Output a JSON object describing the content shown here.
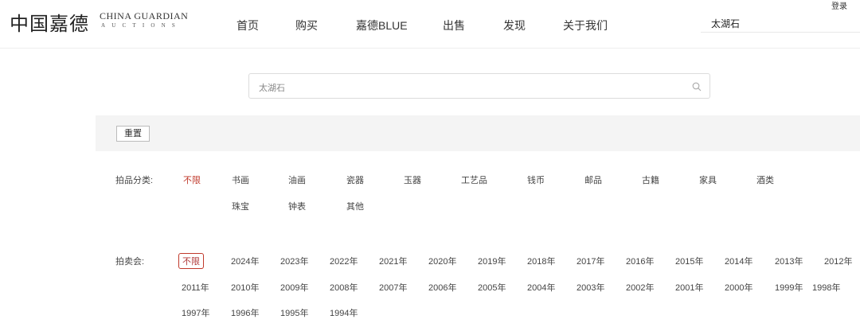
{
  "header": {
    "logo_cn": "中国嘉德",
    "logo_en_line1": "CHINA GUARDIAN",
    "logo_en_line2": "AUCTIONS",
    "nav": [
      "首页",
      "购买",
      "嘉德BLUE",
      "出售",
      "发现",
      "关于我们"
    ],
    "search_text": "太湖石",
    "login": "登录"
  },
  "search": {
    "value": "太湖石",
    "icon": "search-icon"
  },
  "filters": {
    "reset_label": "重置",
    "category_label": "拍品分类:",
    "categories": [
      "不限",
      "书画",
      "油画",
      "瓷器",
      "玉器",
      "工艺品",
      "钱币",
      "邮品",
      "古籍",
      "家具",
      "酒类",
      "珠宝",
      "钟表",
      "其他"
    ],
    "category_active": "不限",
    "auction_label": "拍卖会:",
    "years": [
      "不限",
      "2024年",
      "2023年",
      "2022年",
      "2021年",
      "2020年",
      "2019年",
      "2018年",
      "2017年",
      "2016年",
      "2015年",
      "2014年",
      "2013年",
      "2012年",
      "2011年",
      "2010年",
      "2009年",
      "2008年",
      "2007年",
      "2006年",
      "2005年",
      "2004年",
      "2003年",
      "2002年",
      "2001年",
      "2000年",
      "1999年",
      "1998年",
      "1997年",
      "1996年",
      "1995年",
      "1994年"
    ],
    "year_active": "不限"
  },
  "colors": {
    "accent": "#c0392b",
    "filter_bg": "#f4f4f4"
  }
}
